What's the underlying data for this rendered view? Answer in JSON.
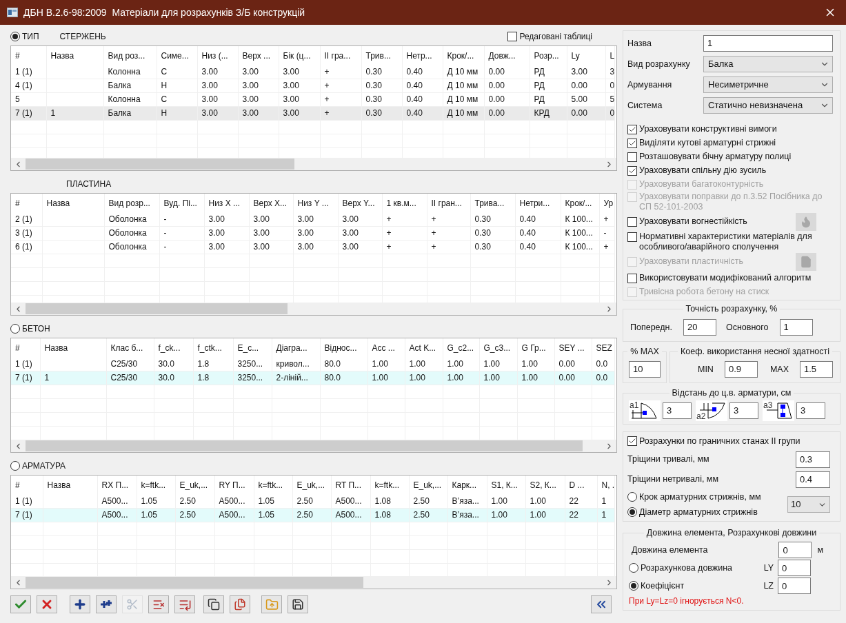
{
  "window": {
    "title": "ДБН В.2.6-98:2009  Матеріали для розрахунків З/Б конструкцій"
  },
  "sections": [
    {
      "radio": {
        "label": "ТИП",
        "selected": true
      },
      "caption": "СТЕРЖЕНЬ",
      "edited_tables": {
        "label": "Редаговані таблиці",
        "checked": false
      },
      "table": {
        "columns": [
          "#",
          "Назва",
          "Вид роз...",
          "Симе...",
          "Низ (...",
          "Верх ...",
          "Бік (ц...",
          "II гра...",
          "Трив...",
          "Нетр...",
          "Крок/...",
          "Довж...",
          "Розр...",
          "Ly",
          "L"
        ],
        "rows": [
          {
            "cells": [
              "1 (1)",
              null,
              "Колонна",
              "С",
              "3.00",
              "3.00",
              "3.00",
              "+",
              "0.30",
              "0.40",
              "Д 10 мм",
              "0.00",
              "РД",
              "3.00",
              "3"
            ],
            "selected": false
          },
          {
            "cells": [
              "4 (1)",
              null,
              "Балка",
              "Н",
              "3.00",
              "3.00",
              "3.00",
              "+",
              "0.30",
              "0.40",
              "Д 10 мм",
              "0.00",
              "РД",
              "0.00",
              "0"
            ],
            "selected": false
          },
          {
            "cells": [
              "5",
              null,
              "Колонна",
              "С",
              "3.00",
              "3.00",
              "3.00",
              "+",
              "0.30",
              "0.40",
              "Д 10 мм",
              "0.00",
              "РД",
              "5.00",
              "5"
            ],
            "selected": false
          },
          {
            "cells": [
              "7 (1)",
              "1",
              "Балка",
              "Н",
              "3.00",
              "3.00",
              "3.00",
              "+",
              "0.30",
              "0.40",
              "Д 10 мм",
              "0.00",
              "КРД",
              "0.00",
              "0"
            ],
            "selected": true
          }
        ]
      }
    },
    {
      "caption": "ПЛАСТИНА",
      "table": {
        "columns": [
          "#",
          "Назва",
          "Вид розр...",
          "Вуд. Пі...",
          "Низ X ...",
          "Верх X...",
          "Низ Y ...",
          "Верх Y...",
          "1 кв.м...",
          "II гран...",
          "Трива...",
          "Нетри...",
          "Крок/...",
          "Ур"
        ],
        "rows": [
          {
            "cells": [
              "2 (1)",
              null,
              "Оболонка",
              "-",
              "3.00",
              "3.00",
              "3.00",
              "3.00",
              "+",
              "+",
              "0.30",
              "0.40",
              "К 100...",
              "+"
            ]
          },
          {
            "cells": [
              "3 (1)",
              null,
              "Оболонка",
              "-",
              "3.00",
              "3.00",
              "3.00",
              "3.00",
              "+",
              "+",
              "0.30",
              "0.40",
              "К 100...",
              "-"
            ]
          },
          {
            "cells": [
              "6 (1)",
              null,
              "Оболонка",
              "-",
              "3.00",
              "3.00",
              "3.00",
              "3.00",
              "+",
              "+",
              "0.30",
              "0.40",
              "К 100...",
              "+"
            ]
          }
        ]
      }
    },
    {
      "radio": {
        "label": "БЕТОН",
        "selected": false
      },
      "table": {
        "columns": [
          "#",
          "Назва",
          "Клас б...",
          "f_ck...",
          "f_ctk...",
          "E_c...",
          "Діагра...",
          "Віднос...",
          "Acc ...",
          "Act K...",
          "G_c2...",
          "G_c3...",
          "G Гр...",
          "SEY ...",
          "SEZ"
        ],
        "rows": [
          {
            "cells": [
              "1 (1)",
              null,
              "C25/30",
              "30.0",
              "1.8",
              "3250...",
              "кривол...",
              "80.0",
              "1.00",
              "1.00",
              "1.00",
              "1.00",
              "1.00",
              "0.00",
              "0.0"
            ],
            "linked": false
          },
          {
            "cells": [
              "7 (1)",
              "1",
              "C25/30",
              "30.0",
              "1.8",
              "3250...",
              "2-лінiй...",
              "80.0",
              "1.00",
              "1.00",
              "1.00",
              "1.00",
              "1.00",
              "0.00",
              "0.0"
            ],
            "linked": true
          }
        ]
      }
    },
    {
      "radio": {
        "label": "АРМАТУРА",
        "selected": false
      },
      "table": {
        "columns": [
          "#",
          "Назва",
          "RX П...",
          "k=ftk...",
          "E_uk,...",
          "RY П...",
          "k=ftk...",
          "E_uk,...",
          "RT П...",
          "k=ftk...",
          "E_uk,...",
          "Карк...",
          "S1, К...",
          "S2, К...",
          "D ...",
          "N, ."
        ],
        "rows": [
          {
            "cells": [
              "1 (1)",
              null,
              "A500...",
              "1.05",
              "2.50",
              "A500...",
              "1.05",
              "2.50",
              "A500...",
              "1.08",
              "2.50",
              "В’яза...",
              "1.00",
              "1.00",
              "22",
              "1"
            ],
            "linked": false
          },
          {
            "cells": [
              "7 (1)",
              null,
              "A500...",
              "1.05",
              "2.50",
              "A500...",
              "1.05",
              "2.50",
              "A500...",
              "1.08",
              "2.50",
              "В’яза...",
              "1.00",
              "1.00",
              "22",
              "1"
            ],
            "linked": true
          }
        ]
      }
    }
  ],
  "toolbar": [
    {
      "kind": "apply",
      "disabled": false
    },
    {
      "kind": "cancel",
      "disabled": false
    },
    {
      "kind": "add",
      "disabled": false
    },
    {
      "kind": "add_many",
      "disabled": false
    },
    {
      "kind": "cut",
      "disabled": true
    },
    {
      "kind": "delete",
      "disabled": false
    },
    {
      "kind": "move",
      "disabled": false
    },
    {
      "kind": "copy",
      "disabled": false
    },
    {
      "kind": "paste",
      "disabled": false
    },
    {
      "kind": "import",
      "disabled": false
    },
    {
      "kind": "save",
      "disabled": false
    },
    {
      "kind": "collapse",
      "disabled": false
    }
  ],
  "properties": {
    "fields": [
      {
        "kind": "input",
        "label": "Назва",
        "value": "1"
      },
      {
        "kind": "select",
        "label": "Вид розрахунку",
        "value": "Балка"
      },
      {
        "kind": "select",
        "label": "Армування",
        "value": "Несиметричне"
      },
      {
        "kind": "select",
        "label": "Система",
        "value": "Статично невизначена"
      }
    ],
    "options": [
      {
        "label": "Ураховувати конструктивні вимоги",
        "checked": true,
        "disabled": false
      },
      {
        "label": "Виділяти кутові арматурні стрижні",
        "checked": true,
        "disabled": false
      },
      {
        "label": "Розташовувати бічну арматуру полиці",
        "checked": false,
        "disabled": false
      },
      {
        "label": "Ураховувати спільну дію зусиль",
        "checked": true,
        "disabled": false
      },
      {
        "label": "Ураховувати багатоконтурність",
        "checked": false,
        "disabled": true
      },
      {
        "label": "Ураховувати поправки до п.3.52 Посібника до СП 52-101-2003",
        "checked": false,
        "disabled": true
      },
      {
        "label": "Ураховувати вогнестійкість",
        "checked": false,
        "disabled": false,
        "side_button": {
          "kind": "fire",
          "disabled": true
        }
      },
      {
        "label": "Нормативні характеристики матеріалів для особливого/аварійного сполучення",
        "checked": false,
        "disabled": false
      },
      {
        "label": "Ураховувати пластичність",
        "checked": false,
        "disabled": true,
        "side_button": {
          "kind": "sheet",
          "disabled": true
        }
      },
      {
        "label": "Використовувати модифікований алгоритм",
        "checked": false,
        "disabled": false
      },
      {
        "label": "Тривісна робота бетону на стиск",
        "checked": false,
        "disabled": true
      }
    ]
  },
  "accuracy": {
    "title": "Точність розрахунку, %",
    "fields": [
      {
        "label": "Попередн.",
        "value": "20"
      },
      {
        "label": "Основного",
        "value": "1"
      }
    ]
  },
  "max_percent": {
    "title": "% MAX",
    "value": "10"
  },
  "utilization": {
    "title": "Коеф. використання несної здатності",
    "fields": [
      {
        "label": "MIN",
        "value": "0.9"
      },
      {
        "label": "MAX",
        "value": "1.5"
      }
    ]
  },
  "cover": {
    "title": "Відстань до ц.в. арматури, см",
    "items": [
      {
        "kind": "bottom",
        "label": "a1",
        "value": "3"
      },
      {
        "kind": "top",
        "label": "a2",
        "value": "3"
      },
      {
        "kind": "side",
        "label": "a3",
        "value": "3"
      }
    ]
  },
  "limit_states": {
    "label": "Розрахунки по граничних станах II групи",
    "checked": true,
    "fields": [
      {
        "label": "Тріщини тривалі, мм",
        "value": "0.3"
      },
      {
        "label": "Тріщини нетривалі, мм",
        "value": "0.4"
      }
    ],
    "modes": [
      {
        "label": "Крок арматурних стрижнів, мм",
        "selected": false
      },
      {
        "label": "Діаметр арматурних стрижнів",
        "selected": true
      }
    ],
    "diameter": "10"
  },
  "lengths": {
    "title": "Довжина елемента, Розрахункові довжини",
    "element": {
      "label": "Довжина елемента",
      "value": "0",
      "unit": "м"
    },
    "modes": [
      {
        "label": "Розрахункова довжина",
        "selected": false,
        "axis": "LY",
        "value": "0"
      },
      {
        "label": "Коефіцієнт",
        "selected": true,
        "axis": "LZ",
        "value": "0"
      }
    ],
    "note": "При Ly=Lz=0 ігнорується N<0."
  }
}
